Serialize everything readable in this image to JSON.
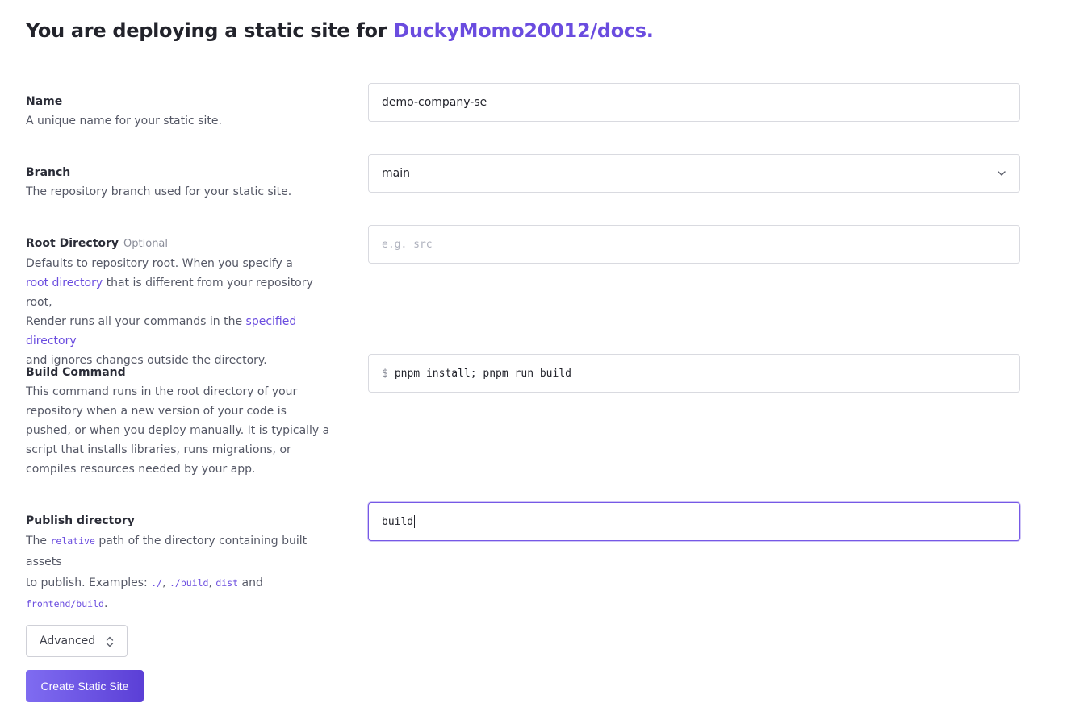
{
  "header": {
    "title_prefix": "You are deploying a static site for ",
    "repo": "DuckyMomo20012/docs."
  },
  "fields": {
    "name": {
      "label": "Name",
      "description": "A unique name for your static site.",
      "value": "demo-company-se"
    },
    "branch": {
      "label": "Branch",
      "description": "The repository branch used for your static site.",
      "value": "main"
    },
    "root_directory": {
      "label": "Root Directory",
      "optional": "Optional",
      "desc_1": "Defaults to repository root. When you specify a",
      "link_1": "root directory",
      "desc_2": " that is different from your repository root,",
      "desc_3": "Render runs all your commands in the ",
      "link_2": "specified directory",
      "desc_4": "and ignores changes outside the directory.",
      "placeholder": "e.g. src",
      "value": ""
    },
    "build_command": {
      "label": "Build Command",
      "description": "This command runs in the root directory of your repository when a new version of your code is pushed, or when you deploy manually. It is typically a script that installs libraries, runs migrations, or compiles resources needed by your app.",
      "prompt": "$",
      "value": "pnpm install; pnpm run build"
    },
    "publish_directory": {
      "label": "Publish directory",
      "desc_the": "The ",
      "code_relative": "relative",
      "desc_mid": " path of the directory containing built assets",
      "desc_to": "to publish. Examples: ",
      "ex_1": "./",
      "sep_1": ", ",
      "ex_2": "./build",
      "sep_2": ", ",
      "ex_3": "dist",
      "sep_3": " and",
      "ex_4": "frontend/build",
      "end": ".",
      "value": "build"
    }
  },
  "buttons": {
    "advanced": "Advanced",
    "create": "Create Static Site"
  },
  "colors": {
    "accent": "#6a4cdf",
    "button_gradient_start": "#7f6cf1",
    "button_gradient_end": "#5b3fd6"
  },
  "icons": {
    "branch_select": "chevron-down-icon",
    "advanced_toggle": "chevron-up-down-icon"
  }
}
